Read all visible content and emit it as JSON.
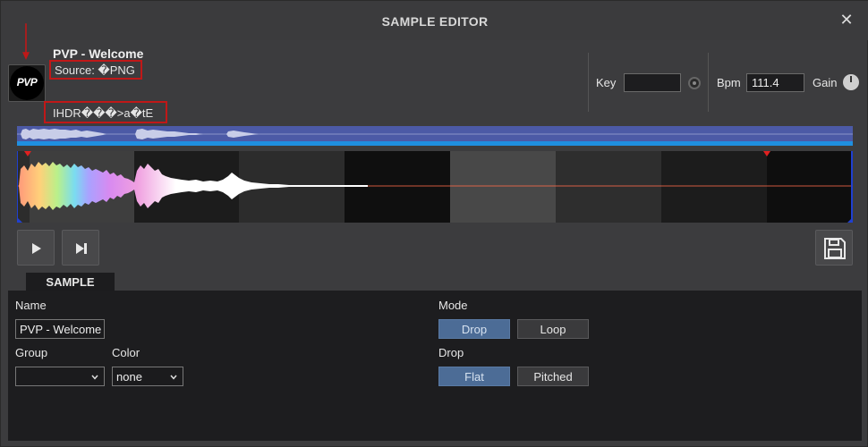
{
  "window": {
    "title": "SAMPLE EDITOR"
  },
  "header": {
    "sample_title": "PVP - Welcome",
    "source_text": "Source: �PNG",
    "ihdr_text": "IHDR���>a�tE",
    "logo_text": "PVP"
  },
  "controls": {
    "key_label": "Key",
    "key_value": "",
    "bpm_label": "Bpm",
    "bpm_value": "111.4",
    "gain_label": "Gain"
  },
  "colors": {
    "annotation_red": "#c01818",
    "active_button": "#4c6c96",
    "overview_bg": "#4c5aa6",
    "overview_bar": "#1f8fe0"
  },
  "tabs": {
    "sample": "SAMPLE"
  },
  "sample_panel": {
    "name_label": "Name",
    "name_value": "PVP - Welcome",
    "group_label": "Group",
    "group_value": "",
    "color_label": "Color",
    "color_value": "none",
    "mode_label": "Mode",
    "mode_options": [
      "Drop",
      "Loop"
    ],
    "mode_selected": "Drop",
    "drop_label": "Drop",
    "drop_options": [
      "Flat",
      "Pitched"
    ],
    "drop_selected": "Flat"
  },
  "icons": {
    "close": "close-icon",
    "play": "play-icon",
    "skip": "skip-to-end-icon",
    "save": "floppy-disk-icon",
    "knob": "knob-icon",
    "arrow": "red-down-arrow-icon"
  }
}
